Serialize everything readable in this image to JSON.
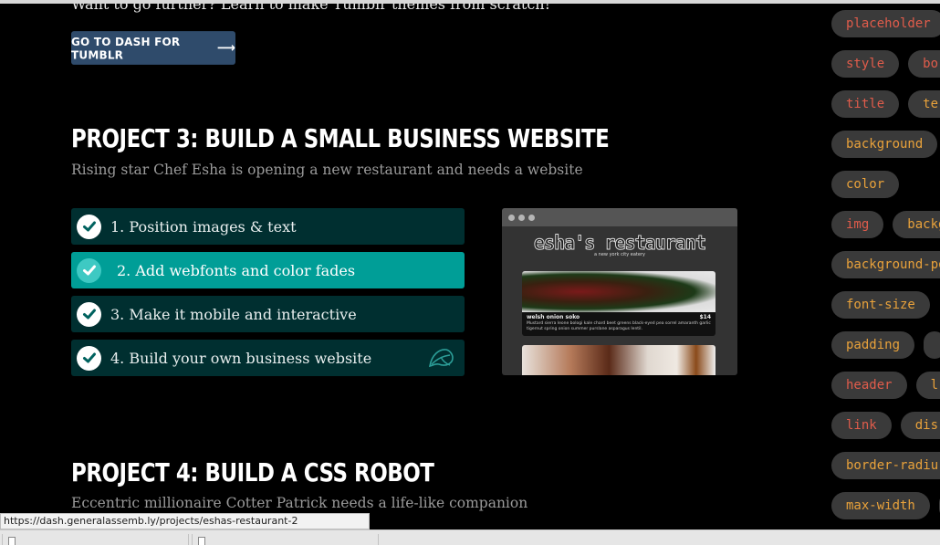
{
  "intro_text": "Want to go further? Learn to make Tumblr themes from scratch!",
  "dash_button": {
    "label": "GO TO DASH FOR TUMBLR",
    "arrow": "⟶"
  },
  "project3": {
    "title": "PROJECT 3: BUILD A SMALL BUSINESS WEBSITE",
    "subtitle": "Rising star Chef Esha is opening a new restaurant and needs a website",
    "steps": [
      {
        "label": "1. Position images & text",
        "completed": true,
        "active": false
      },
      {
        "label": "2. Add webfonts and color fades",
        "completed": true,
        "active": true
      },
      {
        "label": "3. Make it mobile and interactive",
        "completed": true,
        "active": false
      },
      {
        "label": "4. Build your own business website",
        "completed": true,
        "active": false,
        "icon": "leaf-icon"
      }
    ],
    "preview": {
      "restaurant_name": "esha's restaurant",
      "tagline": "a new york city eatery",
      "dish_name": "welsh onion soko",
      "dish_price": "$14",
      "dish_description": "Mustard sierra leone bologi kale chard beet greens black-eyed pea sorrel amaranth garlic tigernut spring onion summer purslane asparagus lentil."
    }
  },
  "project4": {
    "title": "PROJECT 4: BUILD A CSS ROBOT",
    "subtitle": "Eccentric millionaire Cotter Patrick needs a life-like companion"
  },
  "sidebar_tags": [
    [
      "placeholder"
    ],
    [
      "style",
      "bo"
    ],
    [
      "title",
      "te"
    ],
    [
      "background"
    ],
    [
      "color"
    ],
    [
      "img",
      "backg"
    ],
    [
      "background-po"
    ],
    [
      "font-size"
    ],
    [
      "padding"
    ],
    [
      "header",
      "l"
    ],
    [
      "link",
      "dis"
    ],
    [
      "border-radiu"
    ],
    [
      "max-width"
    ]
  ],
  "status_url": "https://dash.generalassemb.ly/projects/eshas-restaurant-2",
  "colors": {
    "step_bg": "#002f30",
    "step_active_bg": "#009e97",
    "button_bg": "#2f4b6b",
    "tag_red": "#e05c4b",
    "tag_orange": "#e9a23b"
  }
}
